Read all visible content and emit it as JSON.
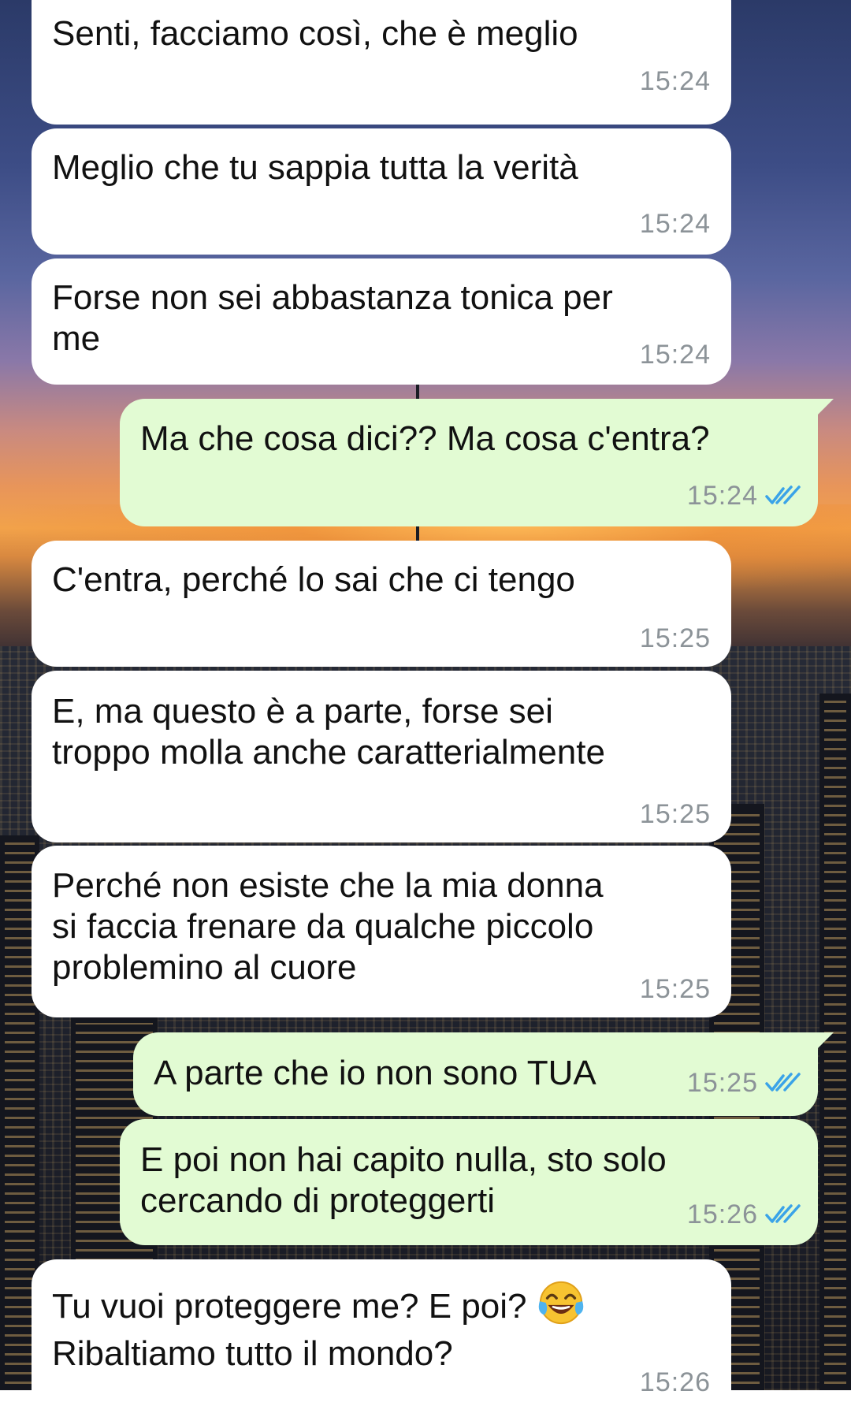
{
  "chat": {
    "messages": [
      {
        "dir": "in",
        "text": "Senti, facciamo così, che è meglio",
        "time": "15:24"
      },
      {
        "dir": "in",
        "text": "Meglio che tu sappia tutta la verità",
        "time": "15:24"
      },
      {
        "dir": "in",
        "text": "Forse non sei abbastanza tonica per\nme",
        "time": "15:24"
      },
      {
        "dir": "out",
        "text": "Ma che cosa dici?? Ma cosa c'entra?",
        "time": "15:24",
        "status": "read"
      },
      {
        "dir": "in",
        "text": "C'entra, perché lo sai che ci tengo",
        "time": "15:25"
      },
      {
        "dir": "in",
        "text": "E, ma questo è a parte, forse sei\ntroppo molla anche caratterialmente",
        "time": "15:25"
      },
      {
        "dir": "in",
        "text": "Perché non esiste che la mia donna\nsi faccia frenare da qualche piccolo\nproblemino al cuore",
        "time": "15:25"
      },
      {
        "dir": "out",
        "text": "A parte che io non sono TUA",
        "time": "15:25",
        "status": "read"
      },
      {
        "dir": "out",
        "text": "E poi non hai capito nulla, sto solo\ncercando di proteggerti",
        "time": "15:26",
        "status": "read"
      },
      {
        "dir": "in",
        "text_line1": "Tu vuoi proteggere me? E poi? ",
        "emoji": "face-with-tears-of-joy-icon",
        "text_line2": "Ribaltiamo tutto il mondo?",
        "time": "15:26"
      }
    ]
  },
  "colors": {
    "incoming_bubble": "#ffffff",
    "outgoing_bubble": "#e2fbd3",
    "timestamp": "#8c9398",
    "read_check": "#3aa3e8"
  }
}
